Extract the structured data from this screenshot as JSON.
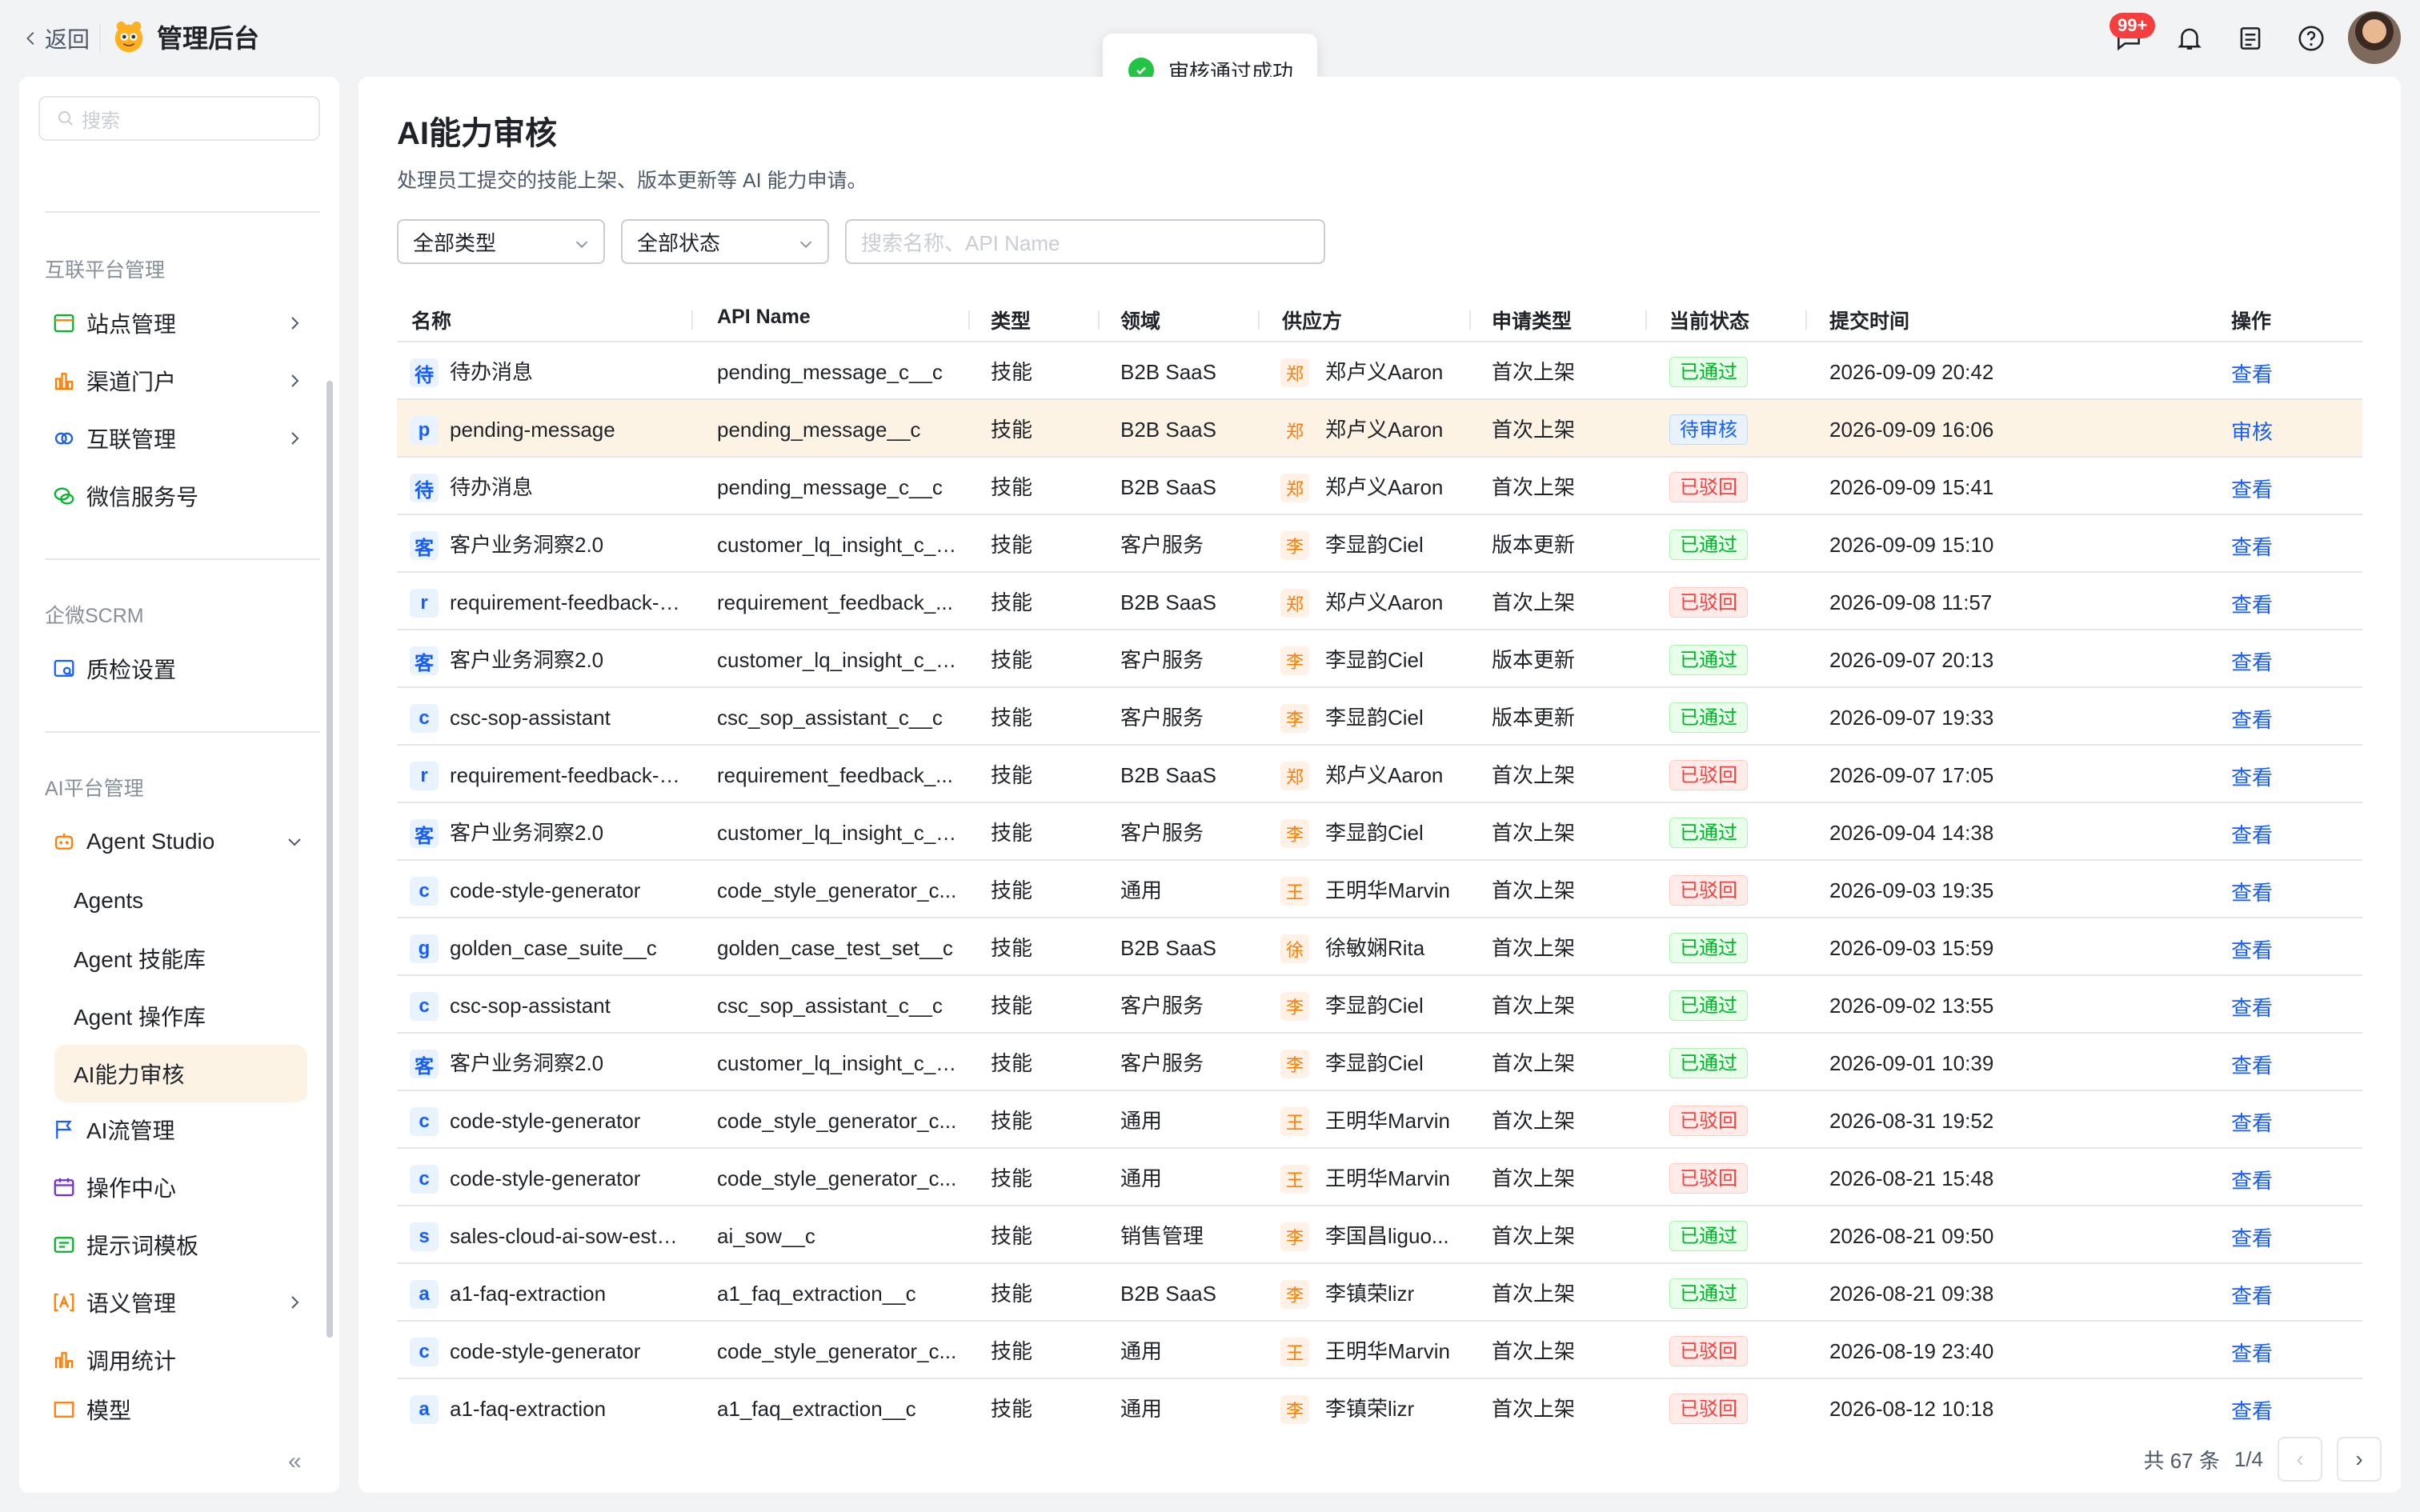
{
  "topbar": {
    "back_label": "返回",
    "app_title": "管理后台",
    "badge": "99+"
  },
  "toast": {
    "message": "审核通过成功"
  },
  "sidebar": {
    "search_placeholder": "搜索",
    "groups": [
      {
        "label": "互联平台管理"
      },
      {
        "label": "企微SCRM"
      },
      {
        "label": "AI平台管理"
      }
    ],
    "items": {
      "site": "站点管理",
      "channel": "渠道门户",
      "interconnect": "互联管理",
      "wechat": "微信服务号",
      "qc": "质检设置",
      "agent_studio": "Agent Studio",
      "agents": "Agents",
      "skill_lib": "Agent 技能库",
      "op_lib": "Agent 操作库",
      "ai_review": "AI能力审核",
      "ai_flow": "AI流管理",
      "op_center": "操作中心",
      "prompt_tpl": "提示词模板",
      "semantic": "语义管理",
      "stats": "调用统计",
      "model": "模型"
    },
    "collapse_icon": "«"
  },
  "page": {
    "title": "AI能力审核",
    "description": "处理员工提交的技能上架、版本更新等 AI 能力申请。",
    "filter_type": "全部类型",
    "filter_status": "全部状态",
    "search_placeholder": "搜索名称、API Name"
  },
  "table": {
    "headers": {
      "name": "名称",
      "api": "API Name",
      "type": "类型",
      "domain": "领域",
      "supplier": "供应方",
      "apply": "申请类型",
      "status": "当前状态",
      "time": "提交时间",
      "op": "操作"
    },
    "rows": [
      {
        "av": "待",
        "name": "待办消息",
        "api": "pending_message_c__c",
        "type": "技能",
        "domain": "B2B SaaS",
        "pav": "郑",
        "supplier": "郑卢义Aaron",
        "apply": "首次上架",
        "status": "已通过",
        "time": "2026-09-09 20:42",
        "op": "查看"
      },
      {
        "av": "p",
        "name": "pending-message",
        "api": "pending_message__c",
        "type": "技能",
        "domain": "B2B SaaS",
        "pav": "郑",
        "supplier": "郑卢义Aaron",
        "apply": "首次上架",
        "status": "待审核",
        "time": "2026-09-09 16:06",
        "op": "审核"
      },
      {
        "av": "待",
        "name": "待办消息",
        "api": "pending_message_c__c",
        "type": "技能",
        "domain": "B2B SaaS",
        "pav": "郑",
        "supplier": "郑卢义Aaron",
        "apply": "首次上架",
        "status": "已驳回",
        "time": "2026-09-09 15:41",
        "op": "查看"
      },
      {
        "av": "客",
        "name": "客户业务洞察2.0",
        "api": "customer_lq_insight_c__c",
        "type": "技能",
        "domain": "客户服务",
        "pav": "李",
        "supplier": "李显韵Ciel",
        "apply": "版本更新",
        "status": "已通过",
        "time": "2026-09-09 15:10",
        "op": "查看"
      },
      {
        "av": "r",
        "name": "requirement-feedback-har",
        "api": "requirement_feedback_...",
        "type": "技能",
        "domain": "B2B SaaS",
        "pav": "郑",
        "supplier": "郑卢义Aaron",
        "apply": "首次上架",
        "status": "已驳回",
        "time": "2026-09-08 11:57",
        "op": "查看"
      },
      {
        "av": "客",
        "name": "客户业务洞察2.0",
        "api": "customer_lq_insight_c__c",
        "type": "技能",
        "domain": "客户服务",
        "pav": "李",
        "supplier": "李显韵Ciel",
        "apply": "版本更新",
        "status": "已通过",
        "time": "2026-09-07 20:13",
        "op": "查看"
      },
      {
        "av": "c",
        "name": "csc-sop-assistant",
        "api": "csc_sop_assistant_c__c",
        "type": "技能",
        "domain": "客户服务",
        "pav": "李",
        "supplier": "李显韵Ciel",
        "apply": "版本更新",
        "status": "已通过",
        "time": "2026-09-07 19:33",
        "op": "查看"
      },
      {
        "av": "r",
        "name": "requirement-feedback-har",
        "api": "requirement_feedback_...",
        "type": "技能",
        "domain": "B2B SaaS",
        "pav": "郑",
        "supplier": "郑卢义Aaron",
        "apply": "首次上架",
        "status": "已驳回",
        "time": "2026-09-07 17:05",
        "op": "查看"
      },
      {
        "av": "客",
        "name": "客户业务洞察2.0",
        "api": "customer_lq_insight_c__c",
        "type": "技能",
        "domain": "客户服务",
        "pav": "李",
        "supplier": "李显韵Ciel",
        "apply": "首次上架",
        "status": "已通过",
        "time": "2026-09-04 14:38",
        "op": "查看"
      },
      {
        "av": "c",
        "name": "code-style-generator",
        "api": "code_style_generator_c...",
        "type": "技能",
        "domain": "通用",
        "pav": "王",
        "supplier": "王明华Marvin",
        "apply": "首次上架",
        "status": "已驳回",
        "time": "2026-09-03 19:35",
        "op": "查看"
      },
      {
        "av": "g",
        "name": "golden_case_suite__c",
        "api": "golden_case_test_set__c",
        "type": "技能",
        "domain": "B2B SaaS",
        "pav": "徐",
        "supplier": "徐敏娴Rita",
        "apply": "首次上架",
        "status": "已通过",
        "time": "2026-09-03 15:59",
        "op": "查看"
      },
      {
        "av": "c",
        "name": "csc-sop-assistant",
        "api": "csc_sop_assistant_c__c",
        "type": "技能",
        "domain": "客户服务",
        "pav": "李",
        "supplier": "李显韵Ciel",
        "apply": "首次上架",
        "status": "已通过",
        "time": "2026-09-02 13:55",
        "op": "查看"
      },
      {
        "av": "客",
        "name": "客户业务洞察2.0",
        "api": "customer_lq_insight_c__c",
        "type": "技能",
        "domain": "客户服务",
        "pav": "李",
        "supplier": "李显韵Ciel",
        "apply": "首次上架",
        "status": "已通过",
        "time": "2026-09-01 10:39",
        "op": "查看"
      },
      {
        "av": "c",
        "name": "code-style-generator",
        "api": "code_style_generator_c...",
        "type": "技能",
        "domain": "通用",
        "pav": "王",
        "supplier": "王明华Marvin",
        "apply": "首次上架",
        "status": "已驳回",
        "time": "2026-08-31 19:52",
        "op": "查看"
      },
      {
        "av": "c",
        "name": "code-style-generator",
        "api": "code_style_generator_c...",
        "type": "技能",
        "domain": "通用",
        "pav": "王",
        "supplier": "王明华Marvin",
        "apply": "首次上架",
        "status": "已驳回",
        "time": "2026-08-21 15:48",
        "op": "查看"
      },
      {
        "av": "s",
        "name": "sales-cloud-ai-sow-estima",
        "api": "ai_sow__c",
        "type": "技能",
        "domain": "销售管理",
        "pav": "李",
        "supplier": "李国昌liguo...",
        "apply": "首次上架",
        "status": "已通过",
        "time": "2026-08-21 09:50",
        "op": "查看"
      },
      {
        "av": "a",
        "name": "a1-faq-extraction",
        "api": "a1_faq_extraction__c",
        "type": "技能",
        "domain": "B2B SaaS",
        "pav": "李",
        "supplier": "李镇荣lizr",
        "apply": "首次上架",
        "status": "已通过",
        "time": "2026-08-21 09:38",
        "op": "查看"
      },
      {
        "av": "c",
        "name": "code-style-generator",
        "api": "code_style_generator_c...",
        "type": "技能",
        "domain": "通用",
        "pav": "王",
        "supplier": "王明华Marvin",
        "apply": "首次上架",
        "status": "已驳回",
        "time": "2026-08-19 23:40",
        "op": "查看"
      },
      {
        "av": "a",
        "name": "a1-faq-extraction",
        "api": "a1_faq_extraction__c",
        "type": "技能",
        "domain": "通用",
        "pav": "李",
        "supplier": "李镇荣lizr",
        "apply": "首次上架",
        "status": "已驳回",
        "time": "2026-08-12 10:18",
        "op": "查看"
      }
    ]
  },
  "pager": {
    "total": "共 67 条",
    "page": "1/4",
    "prev": "‹",
    "next": "›"
  },
  "colors": {
    "accent": "#ff7d00",
    "link": "#165dff",
    "pass": "#00b42a",
    "reject": "#f53f3f",
    "highlight": "#fdf3e5"
  }
}
